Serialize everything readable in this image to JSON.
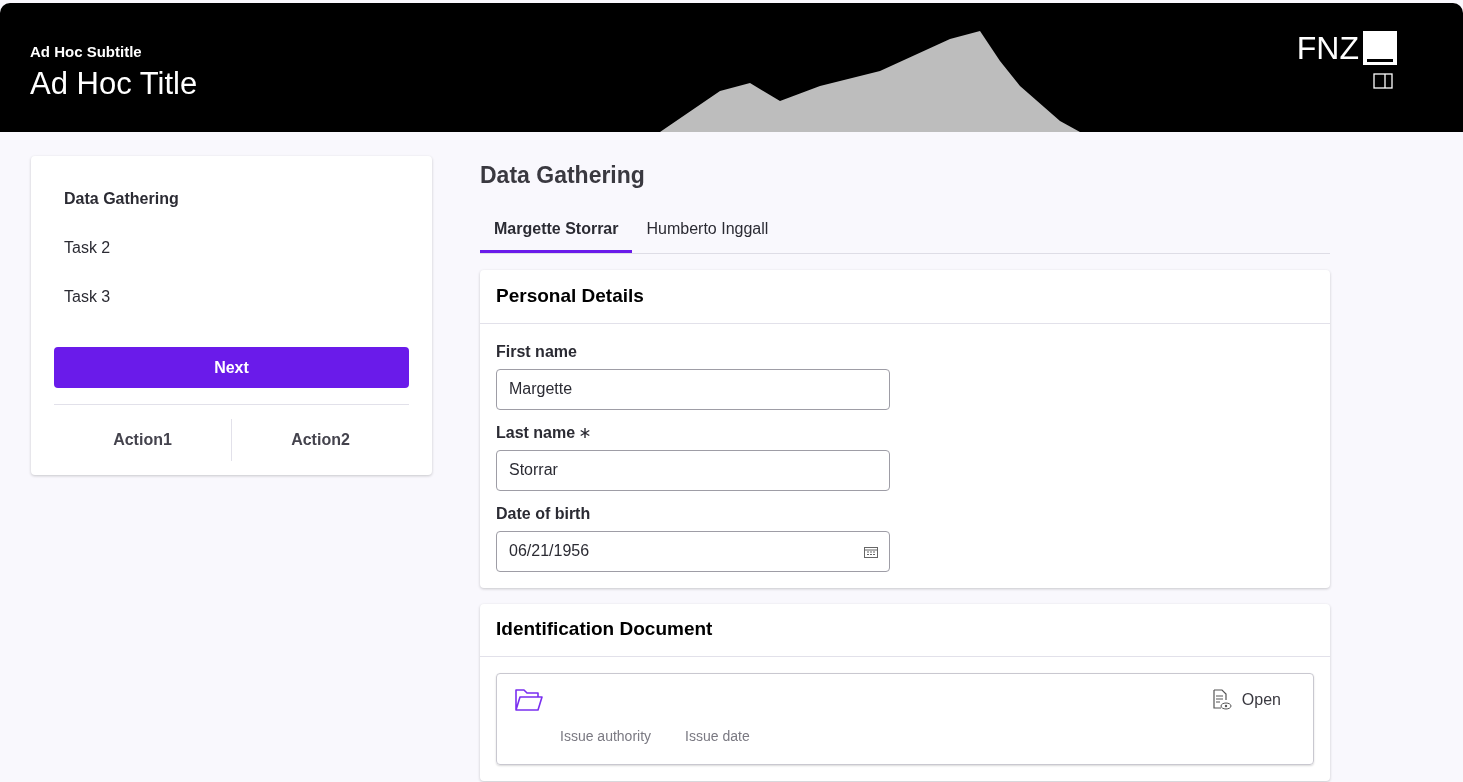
{
  "header": {
    "subtitle": "Ad Hoc Subtitle",
    "title": "Ad Hoc Title",
    "logo": "FNZ"
  },
  "sidebar": {
    "items": [
      {
        "label": "Data Gathering",
        "selected": true
      },
      {
        "label": "Task 2",
        "selected": false
      },
      {
        "label": "Task 3",
        "selected": false
      }
    ],
    "next_button": "Next",
    "actions": [
      "Action1",
      "Action2"
    ]
  },
  "page_title": "Data Gathering",
  "tabs": [
    {
      "label": "Margette Storrar",
      "selected": true
    },
    {
      "label": "Humberto Inggall",
      "selected": false
    }
  ],
  "personal_details": {
    "title": "Personal Details",
    "fields": [
      {
        "label": "First name",
        "value": "Margette",
        "required": false,
        "kind": "text"
      },
      {
        "label": "Last name",
        "value": "Storrar",
        "required": true,
        "kind": "text"
      },
      {
        "label": "Date of birth",
        "value": "06/21/1956",
        "required": false,
        "kind": "date"
      }
    ]
  },
  "identification_document": {
    "title": "Identification Document",
    "open_button": "Open",
    "columns": [
      "Issue authority",
      "Issue date"
    ]
  }
}
